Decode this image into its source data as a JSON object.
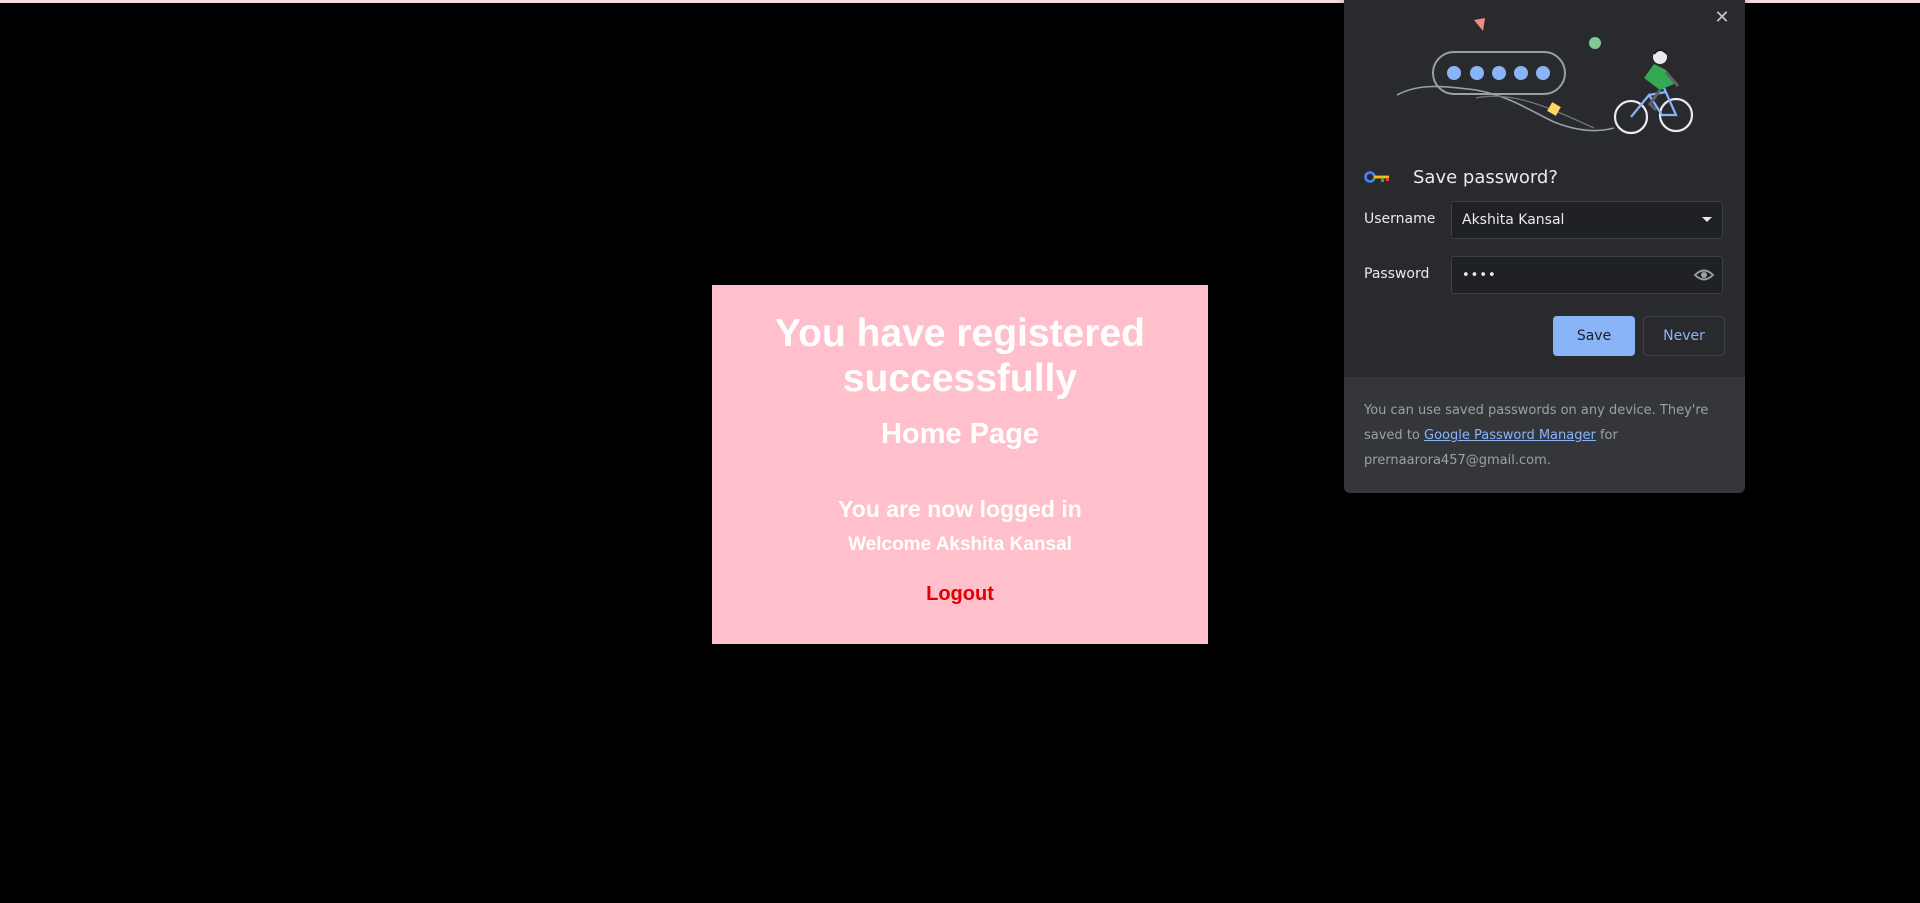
{
  "page": {
    "heading": "You have registered successfully",
    "subheading": "Home Page",
    "status": "You are now logged in",
    "welcome": "Welcome Akshita Kansal",
    "logout": "Logout"
  },
  "colors": {
    "card_bg": "#ffc0cb",
    "logout": "#e00000",
    "page_bg": "#000000",
    "bubble_bg": "#292a2d",
    "accent": "#8ab4f8"
  },
  "password_bubble": {
    "title": "Save password?",
    "username_label": "Username",
    "username_value": "Akshita Kansal",
    "password_label": "Password",
    "password_value": "••••",
    "save_button": "Save",
    "never_button": "Never",
    "footer_prefix": "You can use saved passwords on any device. They're saved to ",
    "footer_link": "Google Password Manager",
    "footer_suffix": " for prernaarora457@gmail.com.",
    "icons": [
      "close-icon",
      "key-icon",
      "dropdown-arrow-icon",
      "eye-icon",
      "password-cyclist-illustration"
    ]
  }
}
